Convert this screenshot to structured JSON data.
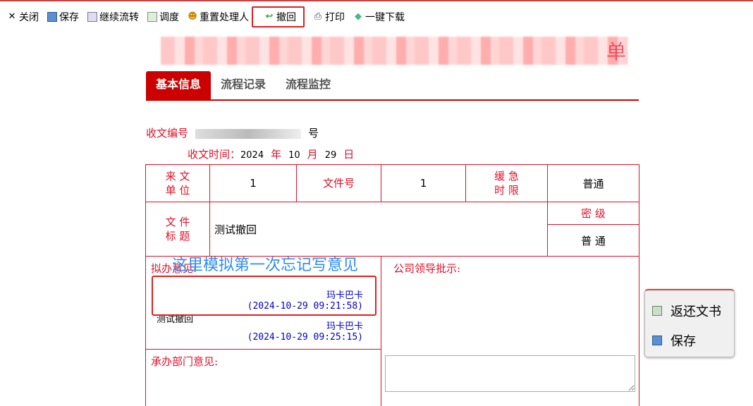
{
  "toolbar": [
    {
      "label": "关闭",
      "icon": "close-icon"
    },
    {
      "label": "保存",
      "icon": "save-icon"
    },
    {
      "label": "继续流转",
      "icon": "forward-icon"
    },
    {
      "label": "调度",
      "icon": "dispatch-icon"
    },
    {
      "label": "重置处理人",
      "icon": "users-icon"
    },
    {
      "label": "撤回",
      "icon": "undo-icon"
    },
    {
      "label": "打印",
      "icon": "print-icon"
    },
    {
      "label": "一键下载",
      "icon": "download-icon"
    }
  ],
  "title_suffix": "单",
  "tabs": [
    "基本信息",
    "流程记录",
    "流程监控"
  ],
  "form": {
    "doc_no_label": "收文编号",
    "doc_no_suffix": "号",
    "recv_time_label": "收文时间：",
    "year": "2024",
    "year_u": "年",
    "month": "10",
    "month_u": "月",
    "day": "29",
    "day_u": "日",
    "from_unit_label": "来 文 单 位",
    "from_unit": "1",
    "file_no_label": "文件号",
    "file_no": "1",
    "urgency_label": "缓 急 时 限",
    "urgency": "普通",
    "file_title_label": "文 件 标 题",
    "file_title": "测试撤回",
    "secret_label": "密 级",
    "secret": "普 通",
    "draft_opinion_label": "拟办意见:",
    "overlay_note": "这里模拟第一次忘记写意见",
    "opinions": [
      {
        "text": "",
        "signer": "玛卡巴卡",
        "time": "(2024-10-29 09:21:58)"
      },
      {
        "text": "测试撤回",
        "signer": "玛卡巴卡",
        "time": "(2024-10-29 09:25:15)"
      }
    ],
    "leader_label": "公司领导批示:",
    "dept_label": "承办部门意见:"
  },
  "popup": [
    {
      "label": "返还文书",
      "icon": "return-icon"
    },
    {
      "label": "保存",
      "icon": "save-icon"
    }
  ]
}
